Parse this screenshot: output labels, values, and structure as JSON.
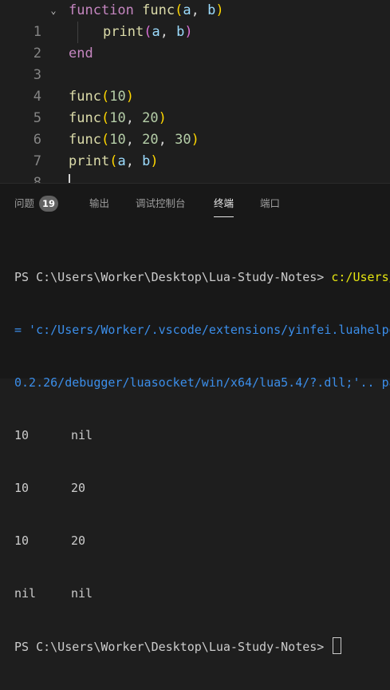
{
  "editor": {
    "lines": [
      {
        "num": "1"
      },
      {
        "num": "2"
      },
      {
        "num": "3"
      },
      {
        "num": "4"
      },
      {
        "num": "5"
      },
      {
        "num": "6"
      },
      {
        "num": "7"
      },
      {
        "num": "8"
      }
    ],
    "tokens": {
      "function": "function",
      "func": "func",
      "print": "print",
      "end": "end",
      "a": "a",
      "b": "b",
      "n10": "10",
      "n20": "20",
      "n30": "30"
    }
  },
  "panel": {
    "tabs": {
      "problems": "问题",
      "problems_count": "19",
      "output": "输出",
      "debug_console": "调试控制台",
      "terminal": "终端",
      "ports": "端口"
    },
    "terminal": {
      "prompt_line": "PS C:\\Users\\Worker\\Desktop\\Lua-Study-Notes> ",
      "command_tail": "c:/Users/",
      "path_line1": "= 'c:/Users/Worker/.vscode/extensions/yinfei.luahelpe",
      "path_line2": "0.2.26/debugger/luasocket/win/x64/lua5.4/?.dll;'.. pa",
      "rows": [
        {
          "c1": "10",
          "c2": "nil"
        },
        {
          "c1": "10",
          "c2": "20"
        },
        {
          "c1": "10",
          "c2": "20"
        },
        {
          "c1": "nil",
          "c2": "nil"
        }
      ],
      "final_prompt": "PS C:\\Users\\Worker\\Desktop\\Lua-Study-Notes> "
    }
  }
}
